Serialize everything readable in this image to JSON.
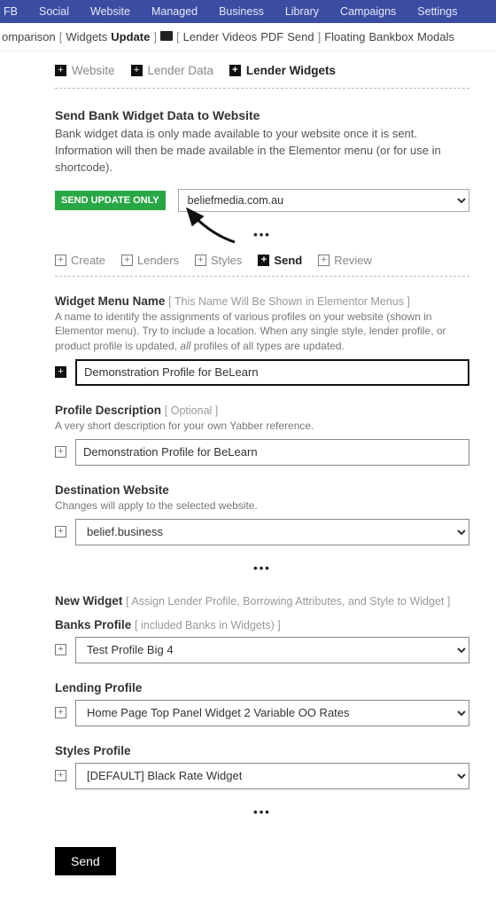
{
  "topnav": [
    "FB",
    "Social",
    "Website",
    "Managed",
    "Business",
    "Library",
    "Campaigns",
    "Settings"
  ],
  "breadcrumb": {
    "parts": [
      "omparison",
      "[",
      "Widgets",
      "Update",
      "]",
      "",
      "[",
      "Lender Videos",
      "PDF",
      "Send",
      "]",
      "Floating",
      "Bankbox",
      "Modals"
    ]
  },
  "tabs_primary": [
    {
      "label": "Website",
      "active": false
    },
    {
      "label": "Lender Data",
      "active": false
    },
    {
      "label": "Lender Widgets",
      "active": true
    }
  ],
  "section": {
    "title": "Send Bank Widget Data to Website",
    "body": "Bank widget data is only made available to your website once it is sent. Information will then be made available in the Elementor menu (or for use in shortcode)."
  },
  "send_update": {
    "button": "SEND UPDATE ONLY",
    "site": "beliefmedia.com.au"
  },
  "subtabs": [
    {
      "label": "Create",
      "active": false
    },
    {
      "label": "Lenders",
      "active": false
    },
    {
      "label": "Styles",
      "active": false
    },
    {
      "label": "Send",
      "active": true
    },
    {
      "label": "Review",
      "active": false
    }
  ],
  "widget_menu": {
    "label": "Widget Menu Name",
    "hint": "[ This Name Will Be Shown in Elementor Menus ]",
    "desc_pre": "A name to identify the assignments of various profiles on your website (shown in Elementor menu). Try to include a location. When any single style, lender profile, or product profile is updated, ",
    "desc_em": "all",
    "desc_post": " profiles of all types are updated.",
    "value": "Demonstration Profile for BeLearn"
  },
  "profile_desc": {
    "label": "Profile Description",
    "hint": "[ Optional ]",
    "desc": "A very short description for your own Yabber reference.",
    "value": "Demonstration Profile for BeLearn"
  },
  "dest_site": {
    "label": "Destination Website",
    "desc": "Changes will apply to the selected website.",
    "value": "belief.business"
  },
  "new_widget": {
    "label": "New Widget",
    "hint": "[ Assign Lender Profile, Borrowing Attributes, and Style to Widget ]"
  },
  "banks_profile": {
    "label": "Banks Profile",
    "hint": "[ included Banks in Widgets) ]",
    "value": "Test Profile Big 4"
  },
  "lending_profile": {
    "label": "Lending Profile",
    "value": "Home Page Top Panel Widget 2 Variable OO Rates"
  },
  "styles_profile": {
    "label": "Styles Profile",
    "value": "[DEFAULT] Black Rate Widget"
  },
  "send_button": "Send"
}
